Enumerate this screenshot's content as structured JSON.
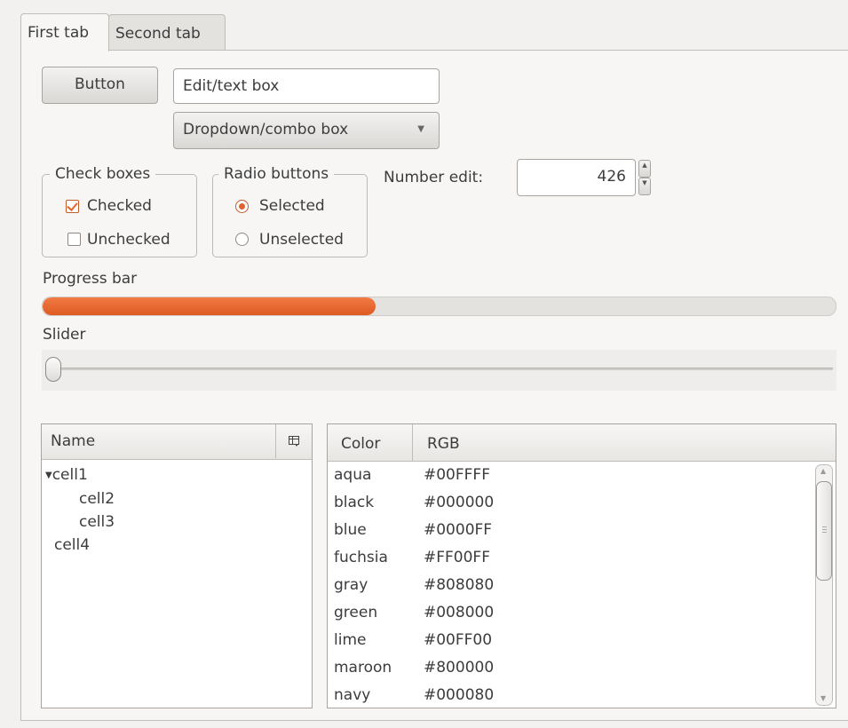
{
  "tabs": [
    {
      "label": "First tab",
      "active": true
    },
    {
      "label": "Second tab",
      "active": false
    }
  ],
  "controls": {
    "button_label": "Button",
    "edit_value": "Edit/text box",
    "combo_value": "Dropdown/combo box",
    "checkboxes": {
      "title": "Check boxes",
      "items": [
        {
          "label": "Checked",
          "checked": true
        },
        {
          "label": "Unchecked",
          "checked": false
        }
      ]
    },
    "radios": {
      "title": "Radio buttons",
      "items": [
        {
          "label": "Selected",
          "selected": true
        },
        {
          "label": "Unselected",
          "selected": false
        }
      ]
    },
    "number_edit": {
      "label": "Number edit:",
      "value": "426"
    },
    "progress": {
      "label": "Progress bar",
      "value_percent": 42
    },
    "slider": {
      "label": "Slider",
      "value_percent": 0
    }
  },
  "tree": {
    "header": "Name",
    "items": [
      {
        "label": "cell1",
        "depth": 0,
        "expanded": true
      },
      {
        "label": "cell2",
        "depth": 1
      },
      {
        "label": "cell3",
        "depth": 1
      },
      {
        "label": "cell4",
        "depth": 0
      }
    ]
  },
  "table": {
    "columns": [
      "Color",
      "RGB"
    ],
    "rows": [
      [
        "aqua",
        "#00FFFF"
      ],
      [
        "black",
        "#000000"
      ],
      [
        "blue",
        "#0000FF"
      ],
      [
        "fuchsia",
        "#FF00FF"
      ],
      [
        "gray",
        "#808080"
      ],
      [
        "green",
        "#008000"
      ],
      [
        "lime",
        "#00FF00"
      ],
      [
        "maroon",
        "#800000"
      ],
      [
        "navy",
        "#000080"
      ]
    ]
  },
  "colors": {
    "accent": "#e2642c",
    "background": "#f2f1f0"
  },
  "icons": {
    "tree_header_button": "column-chooser-icon",
    "combo_arrow": "triangle-down-icon",
    "tree_expander": "triangle-down-icon"
  }
}
